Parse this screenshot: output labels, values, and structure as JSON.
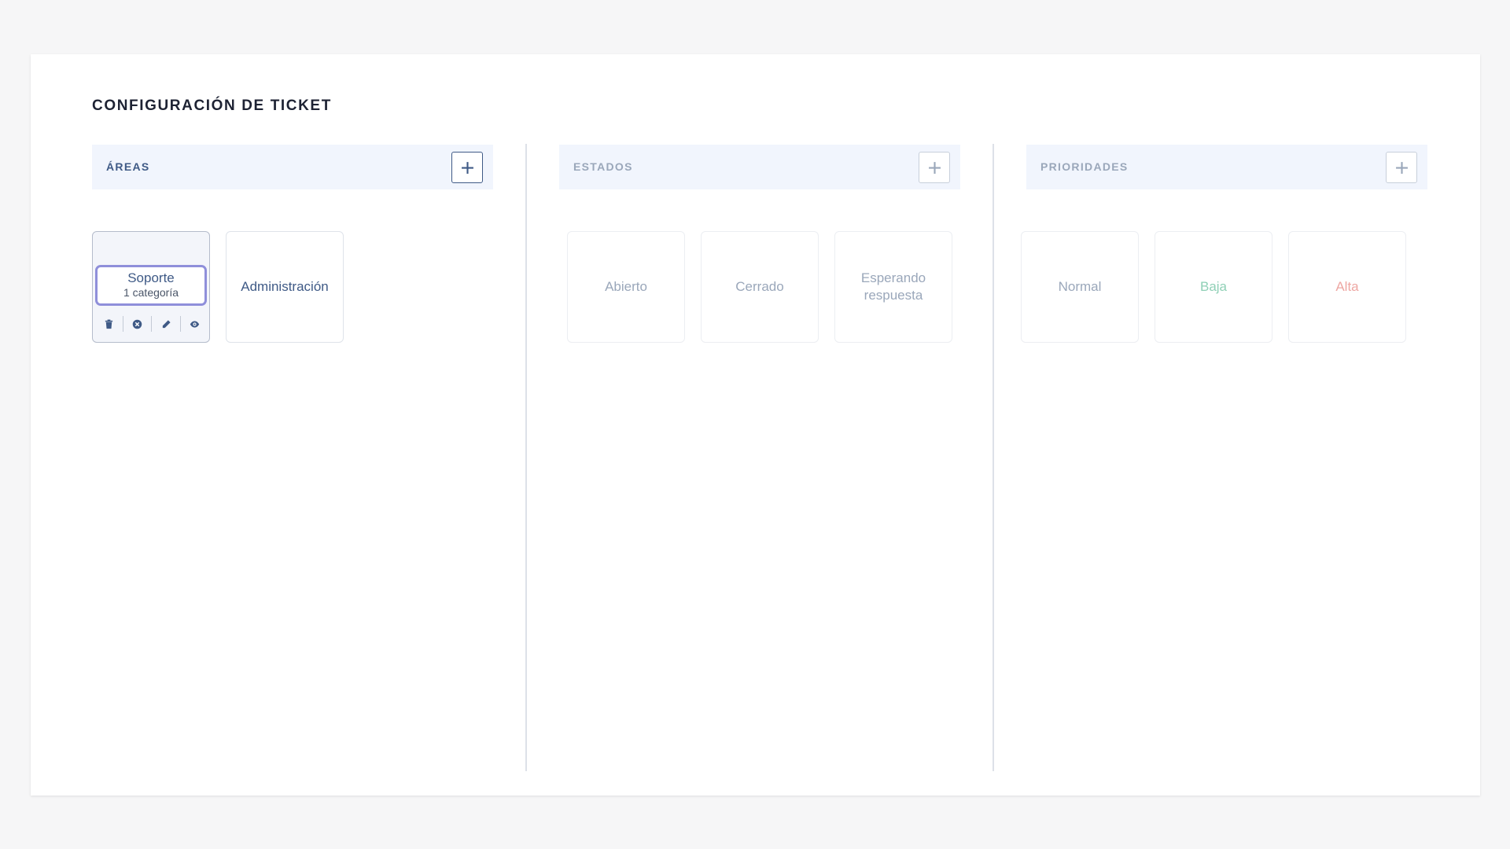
{
  "page": {
    "title": "CONFIGURACIÓN DE TICKET"
  },
  "colors": {
    "accent": "#3f5a86",
    "selected_border": "#8f8fda",
    "muted_text": "#9aa7ba",
    "baja": "#8fd0b6",
    "alta": "#eea7a3"
  },
  "areas": {
    "label": "ÁREAS",
    "add_icon": "plus-icon",
    "items": [
      {
        "name": "Soporte",
        "subtitle": "1 categoría",
        "selected": true
      },
      {
        "name": "Administración",
        "selected": false
      }
    ],
    "actions": [
      "trash-icon",
      "cancel-circle-icon",
      "pencil-icon",
      "eye-icon"
    ]
  },
  "estados": {
    "label": "ESTADOS",
    "add_icon": "plus-icon",
    "items": [
      {
        "name": "Abierto"
      },
      {
        "name": "Cerrado"
      },
      {
        "name": "Esperando respuesta"
      }
    ]
  },
  "prioridades": {
    "label": "PRIORIDADES",
    "add_icon": "plus-icon",
    "items": [
      {
        "name": "Normal",
        "color": "#9aa7ba"
      },
      {
        "name": "Baja",
        "color": "#8fd0b6"
      },
      {
        "name": "Alta",
        "color": "#eea7a3"
      }
    ]
  }
}
